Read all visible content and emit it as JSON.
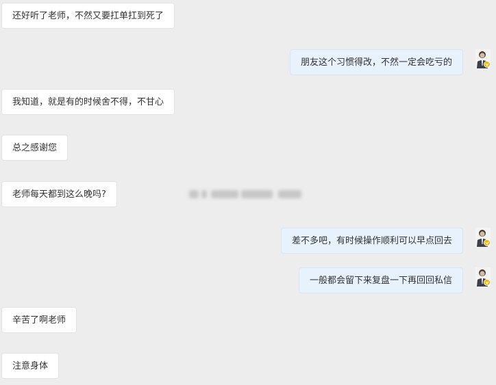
{
  "messages": [
    {
      "side": "left",
      "text": "还好听了老师，不然又要扛单扛到死了"
    },
    {
      "side": "right",
      "text": "朋友这个习惯得改，不然一定会吃亏的"
    },
    {
      "side": "left",
      "text": "我知道，就是有的时候舍不得，不甘心"
    },
    {
      "side": "left",
      "text": "总之感谢您"
    },
    {
      "side": "left",
      "text": "老师每天都到这么晚吗?"
    },
    {
      "side": "right",
      "text": "差不多吧，有时候操作顺利可以早点回去"
    },
    {
      "side": "right",
      "text": "一般都会留下来复盘一下再回回私信"
    },
    {
      "side": "left",
      "text": "辛苦了啊老师"
    },
    {
      "side": "left",
      "text": "注意身体"
    }
  ],
  "colors": {
    "background": "#ededed",
    "left_bubble": "#ffffff",
    "right_bubble": "#e8f2fd",
    "verified_badge": "#f5b400"
  }
}
